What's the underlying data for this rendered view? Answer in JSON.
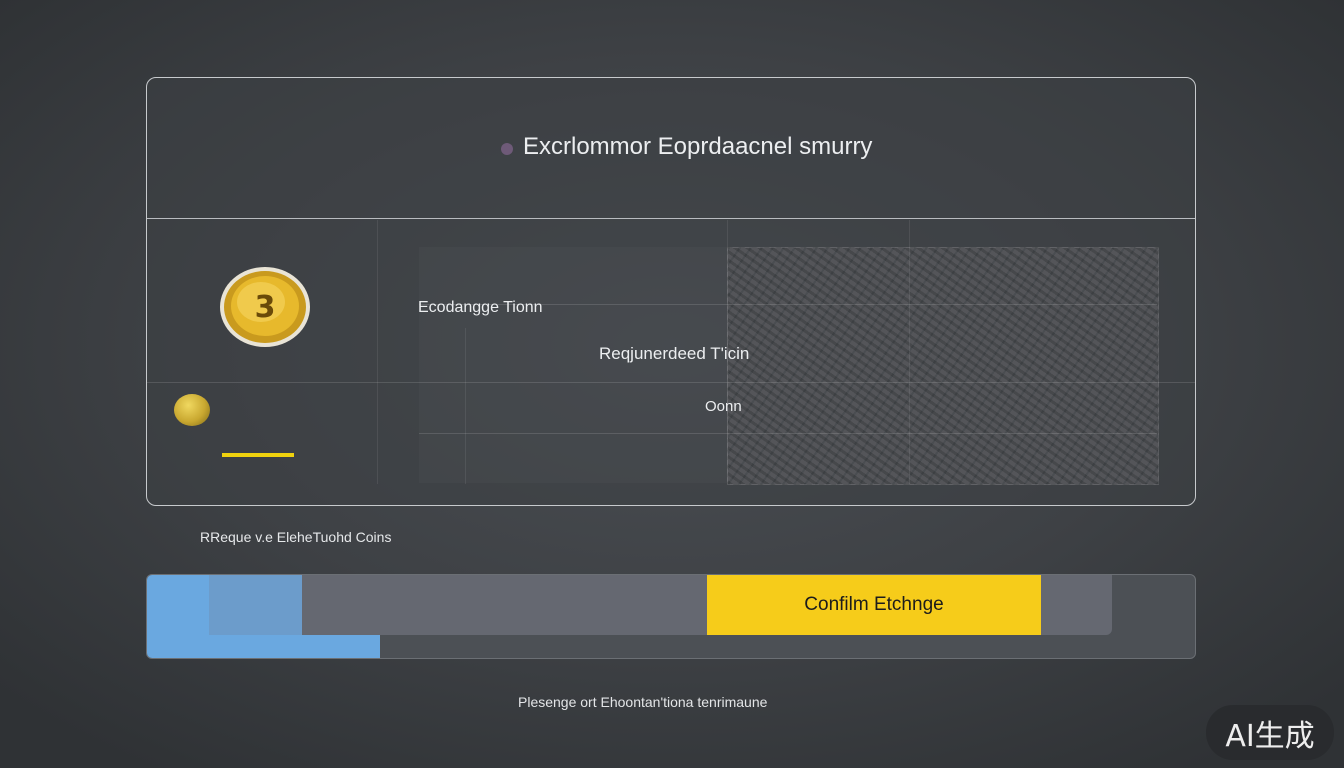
{
  "header": {
    "title": "Excrlommor Eoprdaacnel smurry"
  },
  "exchange": {
    "row_labels": [
      "Ecodangge Tionn",
      "Reqjunerdeed T'icin",
      "Oonn"
    ],
    "coin_icon": "gold-coin-icon",
    "coin_glyph": "3"
  },
  "caption": "RReque v.e EleheTuohd Coins",
  "actions": {
    "confirm_label": "Confilm Etchnge"
  },
  "footer": {
    "note": "Plesenge ort Ehoontan'tiona tenrimaune"
  },
  "watermark": "AI生成",
  "colors": {
    "accent_yellow": "#f6cc1a",
    "accent_blue": "#6aa8e0",
    "panel_border": "#c7cacd",
    "background": "#3e4145"
  }
}
